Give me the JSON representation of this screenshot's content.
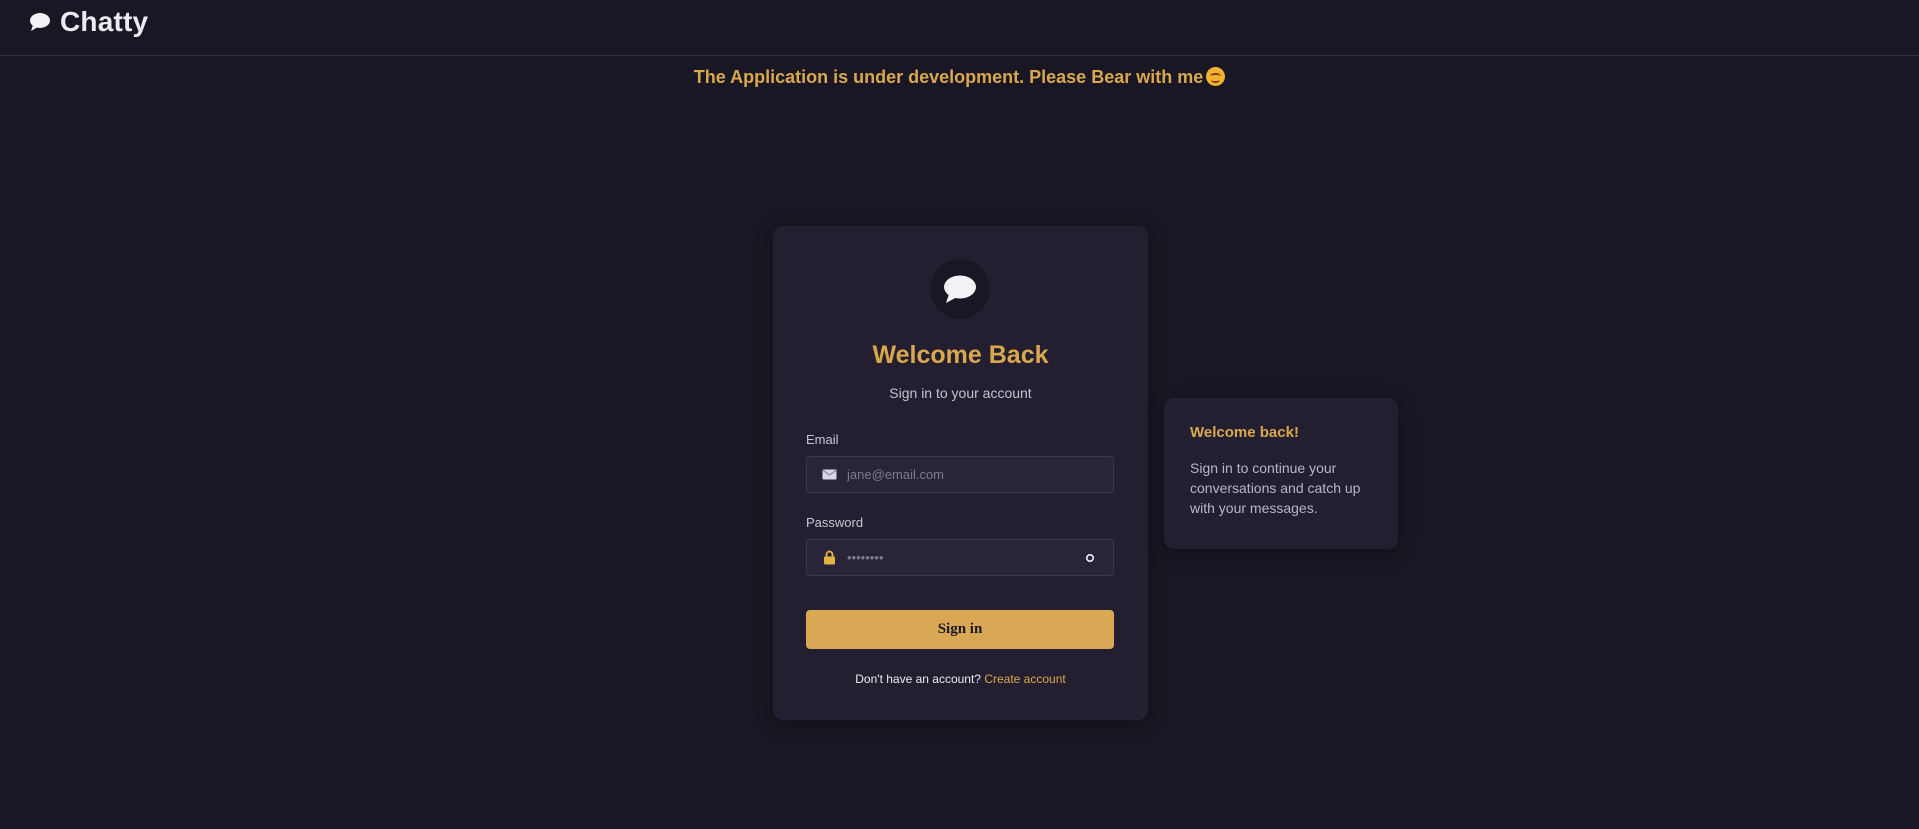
{
  "app": {
    "name": "Chatty",
    "icon": "chat-bubble-icon"
  },
  "banner": {
    "text": "The Application is under development. Please Bear with me",
    "emoji": "smiling-face-icon"
  },
  "login": {
    "title": "Welcome Back",
    "subtitle": "Sign in to your account",
    "email": {
      "label": "Email",
      "placeholder": "jane@email.com",
      "value": ""
    },
    "password": {
      "label": "Password",
      "placeholder": "••••••••",
      "value": ""
    },
    "submit_label": "Sign in",
    "footer_prompt": "Don't have an account?",
    "footer_link": "Create account"
  },
  "side_panel": {
    "title": "Welcome back!",
    "text": "Sign in to continue your conversations and catch up with your messages."
  },
  "colors": {
    "background": "#1a1724",
    "card": "#241f30",
    "accent": "#d9a84e",
    "button": "#d8a854"
  }
}
